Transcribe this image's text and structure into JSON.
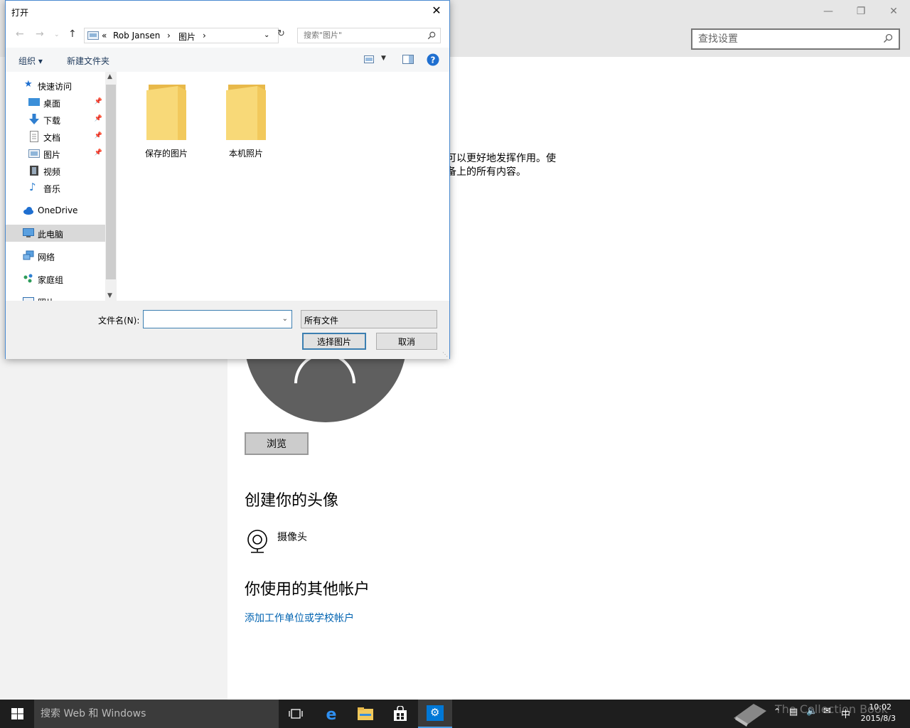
{
  "settings": {
    "search_placeholder": "查找设置",
    "description_line1": "可以更好地发挥作用。使",
    "description_line2": "备上的所有内容。",
    "browse_label": "浏览",
    "create_avatar_heading": "创建你的头像",
    "camera_label": "摄像头",
    "other_accounts_heading": "你使用的其他帐户",
    "add_account_link": "添加工作单位或学校帐户"
  },
  "dialog": {
    "title": "打开",
    "breadcrumb": {
      "overflow": "«",
      "part1": "Rob Jansen",
      "sep": "›",
      "part2": "图片"
    },
    "search_placeholder": "搜索\"图片\"",
    "toolbar": {
      "organize": "组织 ▾",
      "new_folder": "新建文件夹"
    },
    "nav_items": [
      {
        "label": "快速访问"
      },
      {
        "label": "桌面"
      },
      {
        "label": "下载"
      },
      {
        "label": "文档"
      },
      {
        "label": "图片"
      },
      {
        "label": "视频"
      },
      {
        "label": "音乐"
      },
      {
        "label": "OneDrive"
      },
      {
        "label": "此电脑"
      },
      {
        "label": "网络"
      },
      {
        "label": "家庭组"
      },
      {
        "label": "照片"
      }
    ],
    "folders": [
      {
        "label": "保存的图片"
      },
      {
        "label": "本机照片"
      }
    ],
    "filename_label": "文件名(N):",
    "filename_value": "",
    "filetype_value": "所有文件",
    "select_label": "选择图片",
    "cancel_label": "取消"
  },
  "taskbar": {
    "search_placeholder": "搜索 Web 和 Windows",
    "watermark": "The Collection Book",
    "tray_ime": "中",
    "time": "10:02",
    "date": "2015/8/3"
  },
  "colors": {
    "accent": "#0063b1",
    "folder": "#f5d77a",
    "taskbar": "#1e1e1e"
  }
}
